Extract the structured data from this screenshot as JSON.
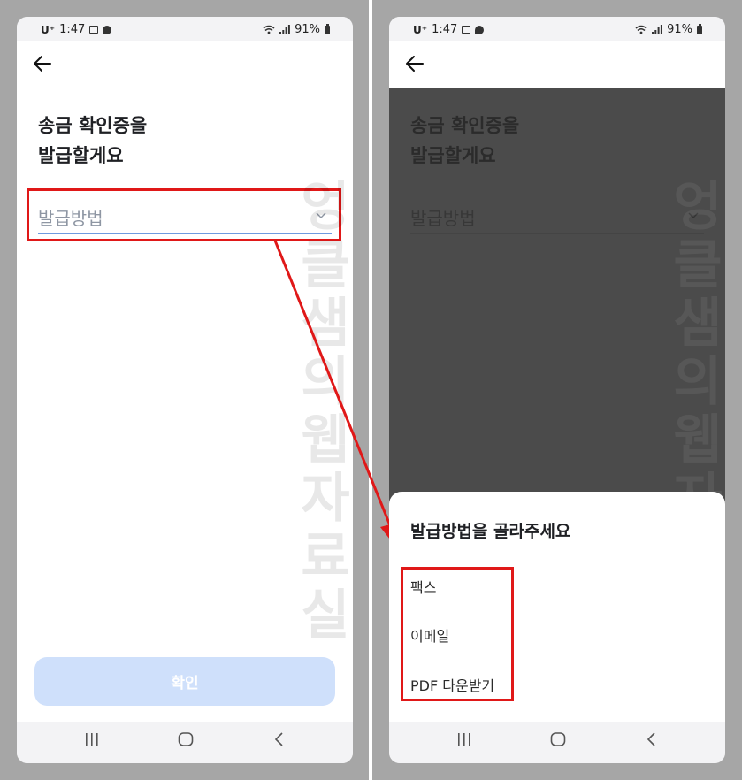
{
  "status": {
    "time": "1:47",
    "battery": "91%"
  },
  "screen1": {
    "title_line1": "송금 확인증을",
    "title_line2": "발급할게요",
    "select_placeholder": "발급방법",
    "confirm_label": "확인",
    "watermark": "엉클샘의웹자료실"
  },
  "screen2": {
    "title_line1": "송금 확인증을",
    "title_line2": "발급할게요",
    "select_placeholder": "발급방법",
    "watermark": "엉클샘의웹자료실",
    "sheet": {
      "title": "발급방법을 골라주세요",
      "options": [
        {
          "label": "팩스"
        },
        {
          "label": "이메일"
        },
        {
          "label": "PDF 다운받기"
        }
      ]
    }
  },
  "colors": {
    "highlight": "#e01818",
    "accent_underline": "#6f9ae0",
    "confirm_disabled": "#cfe0fb"
  }
}
